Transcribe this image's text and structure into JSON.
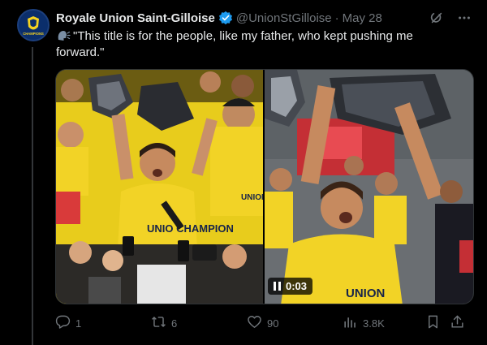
{
  "account": {
    "name": "Royale Union Saint-Gilloise",
    "handle": "@UnionStGilloise",
    "separator": "·",
    "date": "May 28",
    "avatar_text": "CHAMPIONS"
  },
  "tweet": {
    "text": "\"This title is for the people, like my father, who kept pushing me forward.\""
  },
  "media": {
    "video_time": "0:03",
    "shirt_text_left": "UNION CHAMPION",
    "shirt_text_center": "UNIO CHAMPION",
    "shirt_text_right": "UNION"
  },
  "actions": {
    "replies": "1",
    "reposts": "6",
    "likes": "90",
    "views": "3.8K"
  },
  "colors": {
    "background": "#000000",
    "text": "#e7e9ea",
    "muted": "#71767b",
    "verified": "#1d9bf0",
    "union_yellow": "#f5d320",
    "union_blue": "#0b2e6b"
  },
  "icons": [
    "verified-badge-icon",
    "grok-icon",
    "more-icon",
    "speaking-head-icon",
    "pause-icon",
    "reply-icon",
    "repost-icon",
    "like-icon",
    "views-icon",
    "bookmark-icon",
    "share-icon"
  ]
}
